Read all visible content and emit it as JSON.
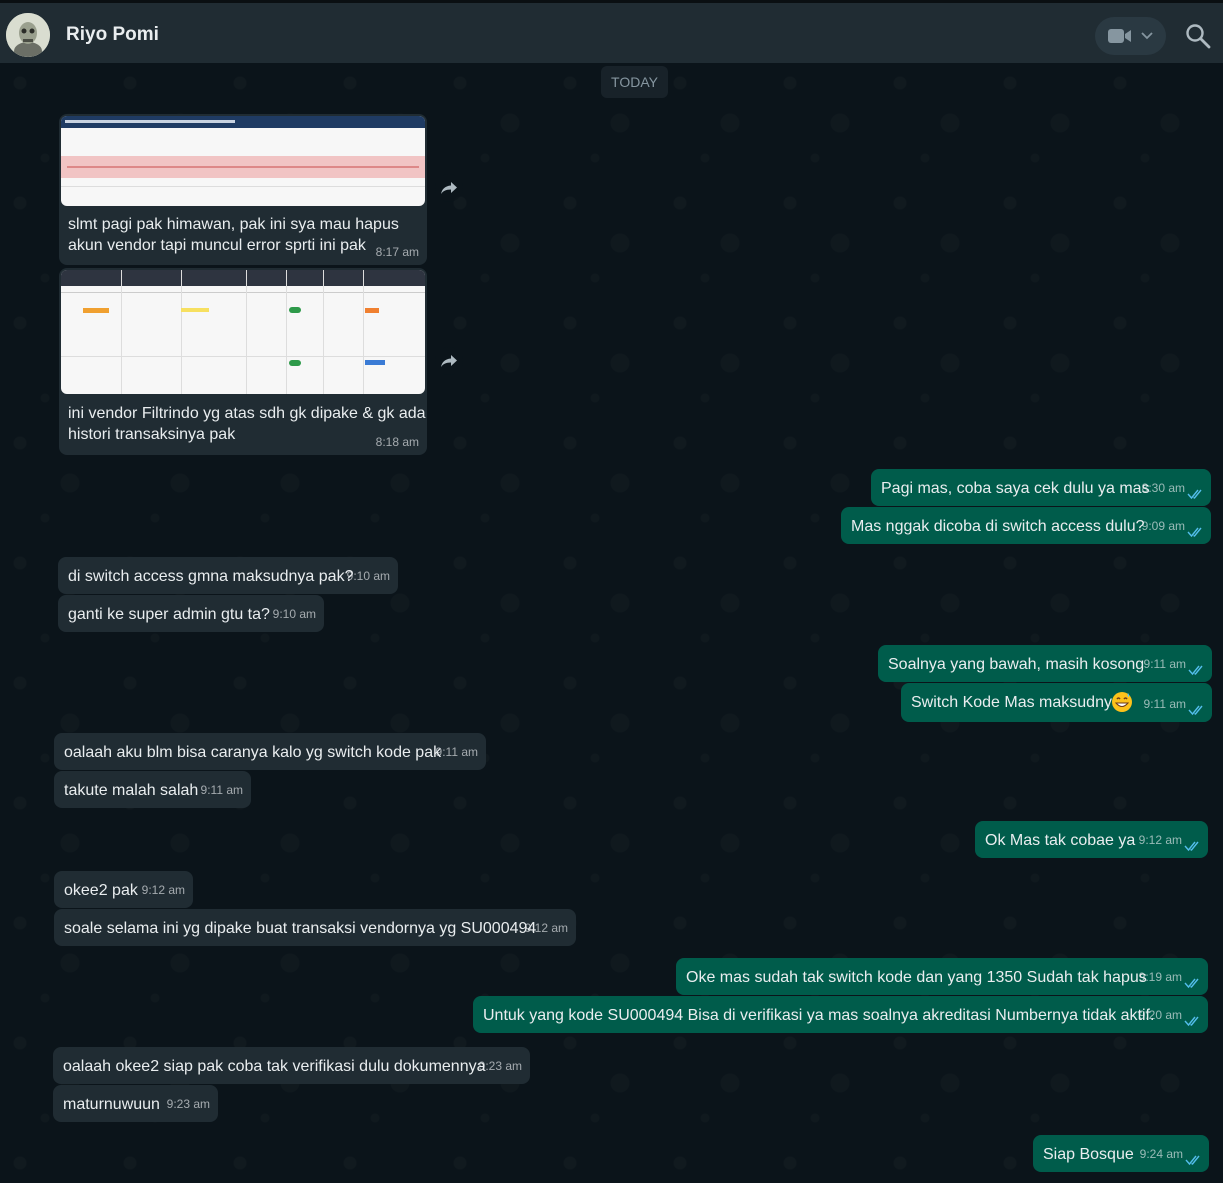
{
  "header": {
    "contact_name": "Riyo Pomi",
    "video_icon": "video-camera-icon",
    "search_icon": "search-icon"
  },
  "colors": {
    "incoming_bubble": "#202c33",
    "outgoing_bubble": "#005c4b",
    "read_tick": "#53bdeb",
    "header_bg": "#202c33"
  },
  "chat": {
    "date_label": "TODAY",
    "image_messages": [
      {
        "caption_lines": [
          "slmt pagi pak himawan, pak ini sya mau hapus",
          "akun vendor tapi muncul error sprti ini pak"
        ],
        "time": "8:17 am"
      },
      {
        "caption_lines": [
          "ini vendor Filtrindo yg atas sdh gk dipake & gk ada",
          "histori transaksinya pak"
        ],
        "time": "8:18 am"
      }
    ],
    "messages": [
      {
        "dir": "out",
        "text": "Pagi mas, coba saya cek dulu ya mas",
        "time": "8:30 am"
      },
      {
        "dir": "out",
        "text": "Mas nggak dicoba di switch access dulu?",
        "time": "9:09 am"
      },
      {
        "dir": "in",
        "text": "di switch access gmna maksudnya pak?",
        "time": "9:10 am"
      },
      {
        "dir": "in",
        "text": "ganti ke super admin gtu ta?",
        "time": "9:10 am"
      },
      {
        "dir": "out",
        "text": "Soalnya yang bawah, masih kosong",
        "time": "9:11 am"
      },
      {
        "dir": "out",
        "text": "Switch Kode Mas maksudnya",
        "time": "9:11 am",
        "emoji": "grinning-sweat-emoji"
      },
      {
        "dir": "in",
        "text": "oalaah aku blm bisa caranya kalo yg switch kode pak",
        "time": "9:11 am"
      },
      {
        "dir": "in",
        "text": "takute malah salah",
        "time": "9:11 am"
      },
      {
        "dir": "out",
        "text": "Ok Mas tak cobae ya",
        "time": "9:12 am"
      },
      {
        "dir": "in",
        "text": "okee2 pak",
        "time": "9:12 am"
      },
      {
        "dir": "in",
        "text": "soale selama ini yg dipake buat transaksi vendornya yg SU000494",
        "time": "9:12 am"
      },
      {
        "dir": "out",
        "text": "Oke mas sudah tak switch kode dan yang 1350 Sudah tak hapus",
        "time": "9:19 am"
      },
      {
        "dir": "out",
        "text": "Untuk yang kode SU000494 Bisa di verifikasi ya mas soalnya akreditasi Numbernya tidak aktif.",
        "time": "9:20 am"
      },
      {
        "dir": "in",
        "text": "oalaah okee2 siap pak coba tak verifikasi dulu dokumennya",
        "time": "9:23 am"
      },
      {
        "dir": "in",
        "text": "maturnuwuun",
        "time": "9:23 am"
      },
      {
        "dir": "out",
        "text": "Siap Bosque",
        "time": "9:24 am"
      }
    ]
  }
}
